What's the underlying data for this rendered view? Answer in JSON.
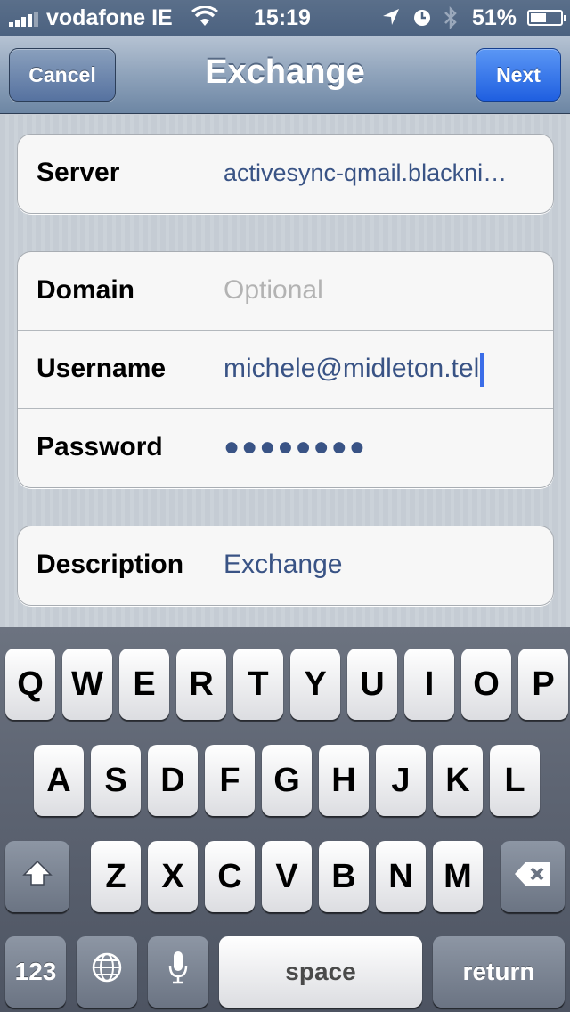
{
  "status_bar": {
    "carrier": "vodafone IE",
    "time": "15:19",
    "battery": "51%",
    "battery_level": 0.51,
    "icons": [
      "signal-icon",
      "wifi-icon",
      "location-icon",
      "alarm-icon",
      "bluetooth-icon",
      "battery-icon"
    ]
  },
  "nav": {
    "title": "Exchange",
    "cancel_label": "Cancel",
    "next_label": "Next"
  },
  "server_group": {
    "server_label": "Server",
    "server_value": "activesync-qmail.blackni…"
  },
  "account_group": {
    "domain_label": "Domain",
    "domain_placeholder": "Optional",
    "username_label": "Username",
    "username_value": "michele@midleton.tel",
    "password_label": "Password",
    "password_value": "●●●●●●●●"
  },
  "description_group": {
    "description_label": "Description",
    "description_value": "Exchange"
  },
  "keyboard": {
    "row1": [
      "Q",
      "W",
      "E",
      "R",
      "T",
      "Y",
      "U",
      "I",
      "O",
      "P"
    ],
    "row2": [
      "A",
      "S",
      "D",
      "F",
      "G",
      "H",
      "J",
      "K",
      "L"
    ],
    "row3": [
      "Z",
      "X",
      "C",
      "V",
      "B",
      "N",
      "M"
    ],
    "numbers_label": "123",
    "space_label": "space",
    "return_label": "return",
    "icons": [
      "shift-icon",
      "backspace-icon",
      "globe-icon",
      "microphone-icon"
    ]
  },
  "colors": {
    "accent_blue": "#1f5fe0",
    "value_text": "#395385",
    "nav_bar": "#8fa3bb"
  }
}
